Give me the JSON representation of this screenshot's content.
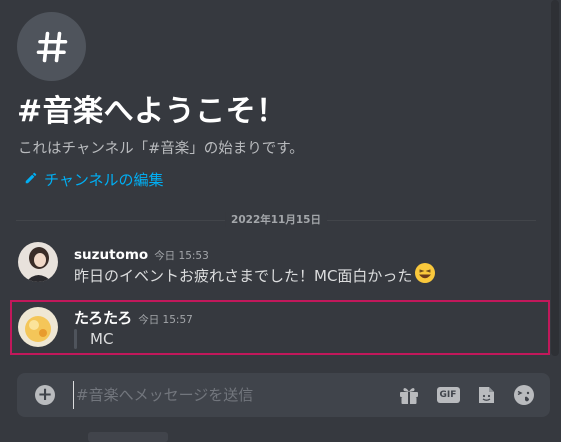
{
  "channel": {
    "icon_name": "hashtag-icon",
    "welcome_title": "#音楽へようこそ！",
    "welcome_desc": "これはチャンネル「#音楽」の始まりです。",
    "edit_label": "チャンネルの編集"
  },
  "divider": {
    "date": "2022年11月15日"
  },
  "messages": [
    {
      "author": "suzutomo",
      "timestamp": "今日 15:53",
      "text": "昨日のイベントお疲れさまでした！MC面白かった",
      "emoji": "laughing-face-emoji"
    },
    {
      "author": "たろたろ",
      "timestamp": "今日 15:57",
      "text": "MC"
    }
  ],
  "composer": {
    "placeholder": "#音楽へメッセージを送信",
    "gif_label": "GIF"
  },
  "colors": {
    "accent": "#00aff4",
    "highlight_border": "#c2185b",
    "background": "#36393f"
  }
}
